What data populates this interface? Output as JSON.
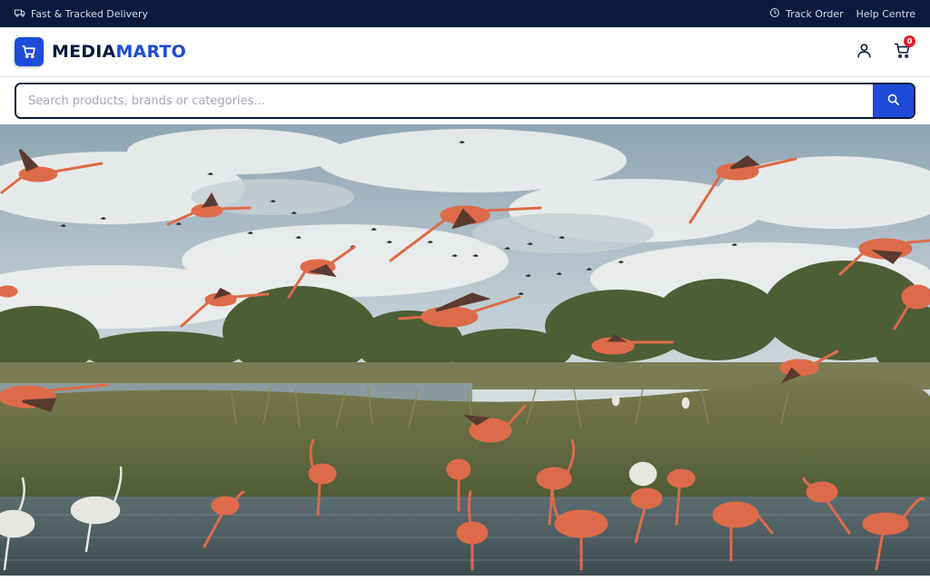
{
  "topbar": {
    "delivery_text": "Fast & Tracked Delivery",
    "track_order": "Track Order",
    "help_centre": "Help Centre"
  },
  "header": {
    "brand_part1": "MEDIA",
    "brand_part2": "MARTO",
    "cart_count": "0"
  },
  "search": {
    "placeholder": "Search products, brands or categories..."
  },
  "hero": {
    "image_alt": "Flamingos in flight over a wetland"
  },
  "colors": {
    "navy": "#0a1a3c",
    "brand_blue": "#1e4bd8",
    "badge_red": "#e11d2e"
  },
  "icons": [
    "truck-icon",
    "clock-icon",
    "cart-icon",
    "user-icon",
    "search-icon"
  ]
}
